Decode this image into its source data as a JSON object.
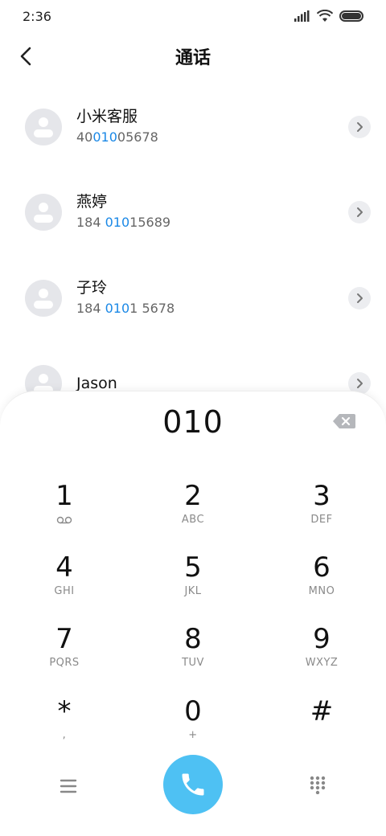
{
  "status_bar": {
    "time": "2:36"
  },
  "header": {
    "title": "通话"
  },
  "contacts": [
    {
      "name": "小米客服",
      "number_pre": "40",
      "number_hl": "010",
      "number_post": "05678"
    },
    {
      "name": "燕婷",
      "number_pre": "184 ",
      "number_hl": "010",
      "number_post": "15689"
    },
    {
      "name": "子玲",
      "number_pre": "184 ",
      "number_hl": "010",
      "number_post": "1 5678"
    },
    {
      "name": "Jason",
      "number_pre": "",
      "number_hl": "",
      "number_post": ""
    }
  ],
  "dialpad": {
    "input_value": "010",
    "keys": [
      {
        "digit": "1",
        "letters": ""
      },
      {
        "digit": "2",
        "letters": "ABC"
      },
      {
        "digit": "3",
        "letters": "DEF"
      },
      {
        "digit": "4",
        "letters": "GHI"
      },
      {
        "digit": "5",
        "letters": "JKL"
      },
      {
        "digit": "6",
        "letters": "MNO"
      },
      {
        "digit": "7",
        "letters": "PQRS"
      },
      {
        "digit": "8",
        "letters": "TUV"
      },
      {
        "digit": "9",
        "letters": "WXYZ"
      },
      {
        "digit": "*",
        "letters": ","
      },
      {
        "digit": "0",
        "letters": "+"
      },
      {
        "digit": "#",
        "letters": ""
      }
    ]
  },
  "colors": {
    "accent": "#1a88e6",
    "call_button": "#4ec1f3"
  },
  "icons": [
    "back-arrow-icon",
    "chevron-right-icon",
    "backspace-icon",
    "voicemail-icon",
    "menu-icon",
    "phone-icon",
    "dialpad-icon",
    "signal-icon",
    "wifi-icon",
    "battery-icon"
  ]
}
